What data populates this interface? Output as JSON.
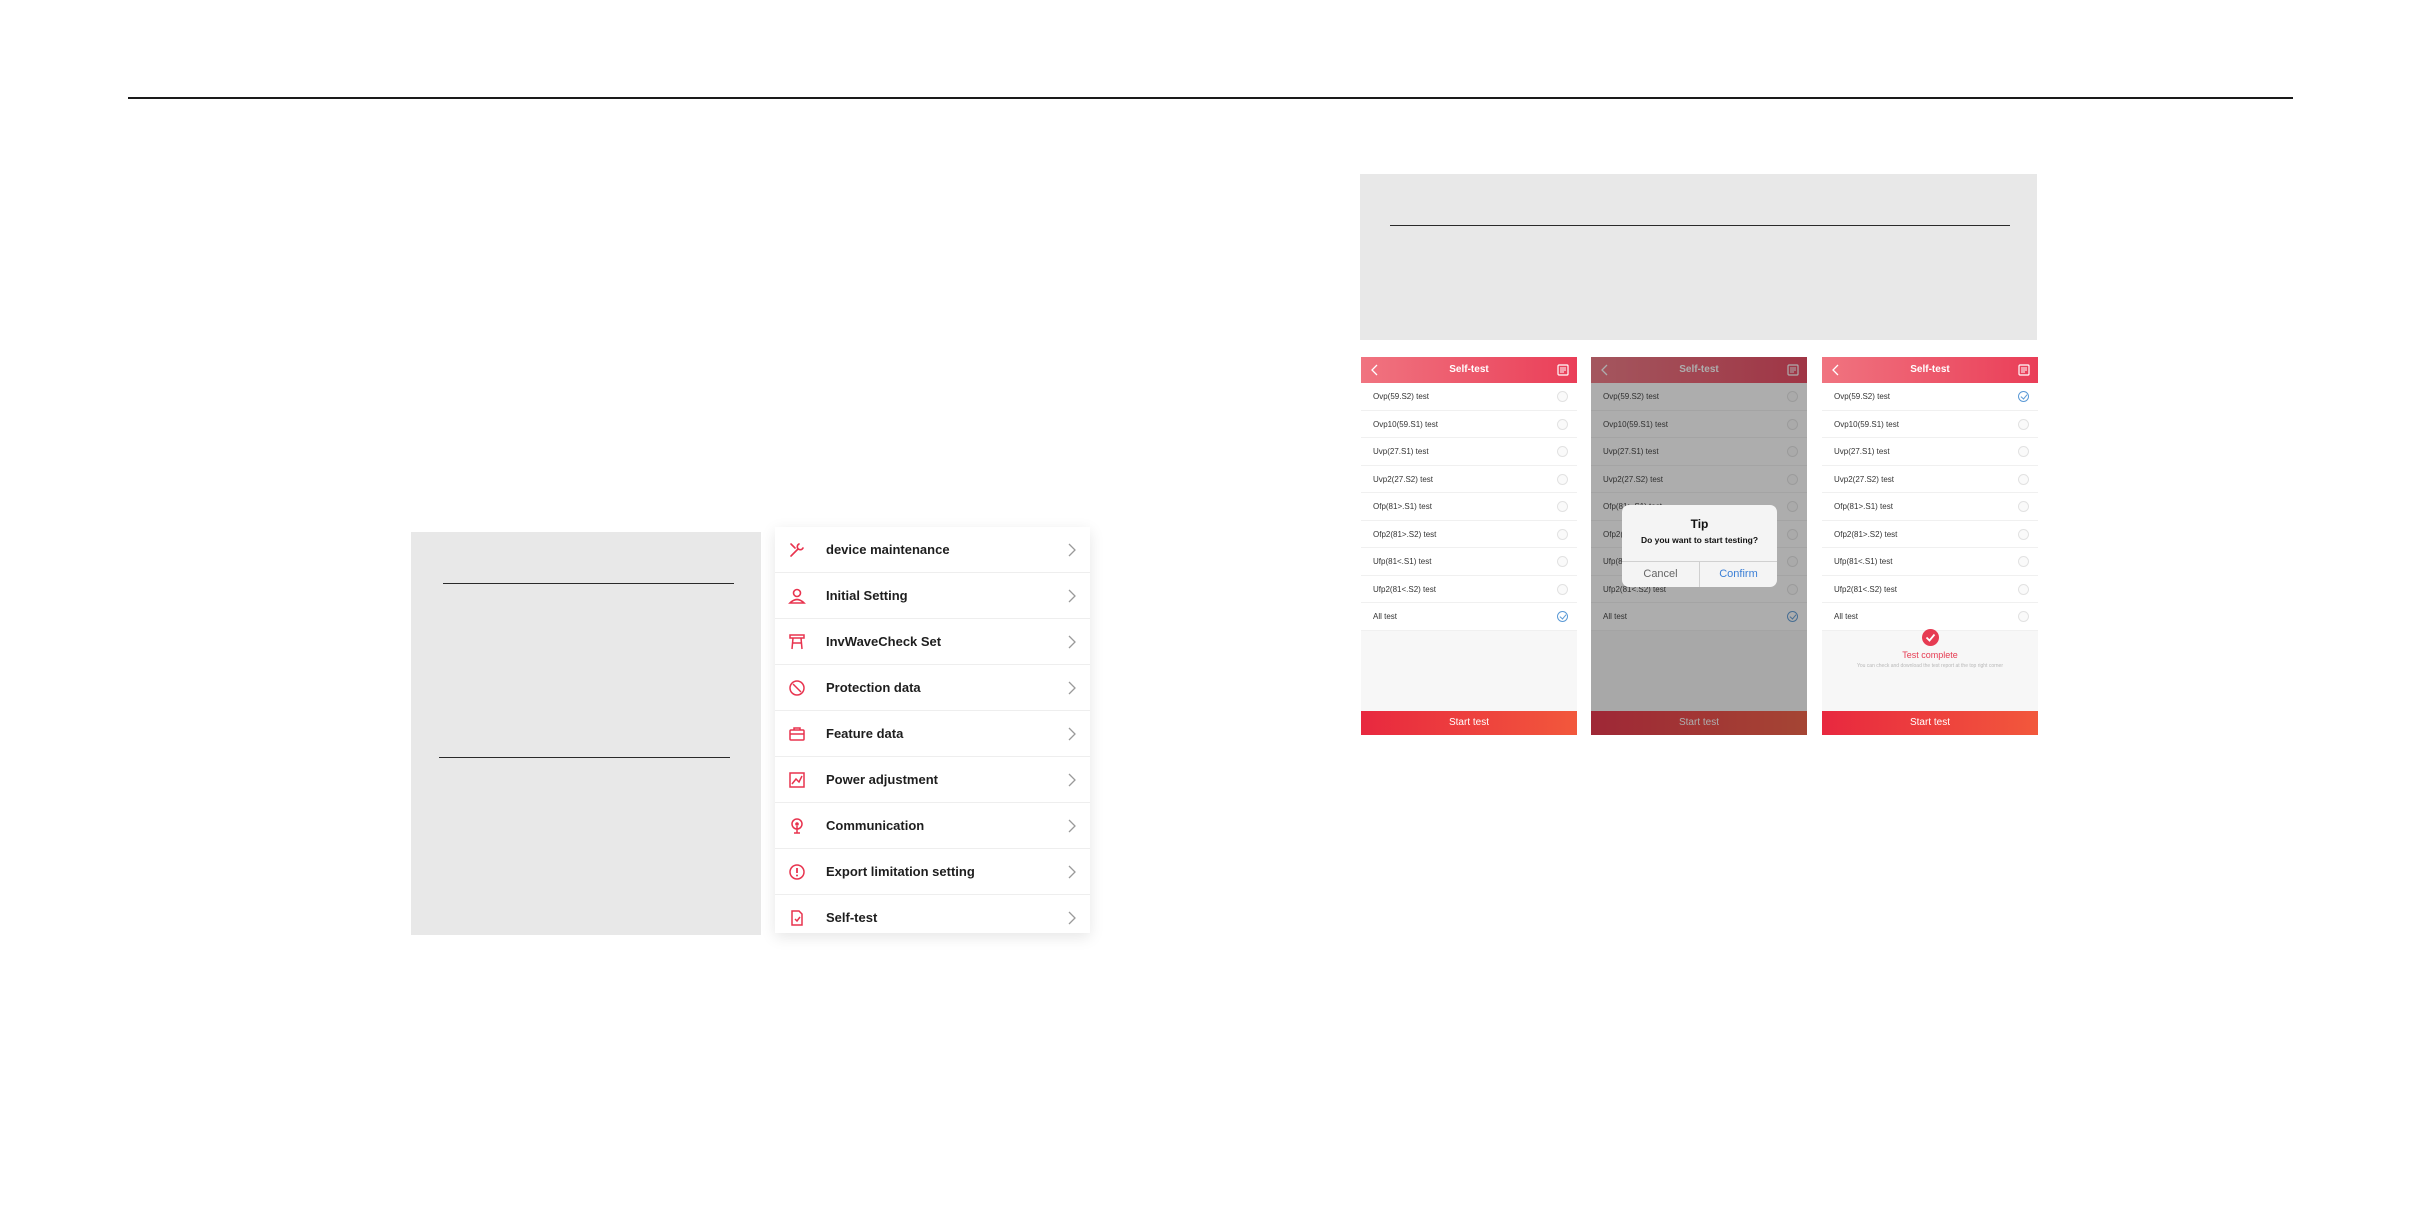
{
  "settings_menu": {
    "items": [
      {
        "label": "device maintenance",
        "icon": "wrench-icon"
      },
      {
        "label": "Initial Setting",
        "icon": "user-setting-icon"
      },
      {
        "label": "InvWaveCheck Set",
        "icon": "tower-icon"
      },
      {
        "label": "Protection data",
        "icon": "shield-icon"
      },
      {
        "label": "Feature data",
        "icon": "briefcase-icon"
      },
      {
        "label": "Power adjustment",
        "icon": "chart-adjust-icon"
      },
      {
        "label": "Communication",
        "icon": "antenna-icon"
      },
      {
        "label": "Export limitation setting",
        "icon": "gauge-icon"
      },
      {
        "label": "Self-test",
        "icon": "document-check-icon"
      }
    ]
  },
  "phones": [
    {
      "title": "Self-test",
      "tests": [
        {
          "label": "Ovp(59.S2)  test",
          "checked": false
        },
        {
          "label": "Ovp10(59.S1)  test",
          "checked": false
        },
        {
          "label": "Uvp(27.S1)  test",
          "checked": false
        },
        {
          "label": "Uvp2(27.S2)  test",
          "checked": false
        },
        {
          "label": "Ofp(81>.S1)  test",
          "checked": false
        },
        {
          "label": "Ofp2(81>.S2)  test",
          "checked": false
        },
        {
          "label": "Ufp(81<.S1)  test",
          "checked": false
        },
        {
          "label": "Ufp2(81<.S2)  test",
          "checked": false
        },
        {
          "label": "All  test",
          "checked": true
        }
      ],
      "start_button": "Start test"
    },
    {
      "title": "Self-test",
      "tests": [
        {
          "label": "Ovp(59.S2)  test",
          "checked": false
        },
        {
          "label": "Ovp10(59.S1)  test",
          "checked": false
        },
        {
          "label": "Uvp(27.S1)  test",
          "checked": false
        },
        {
          "label": "Uvp2(27.S2)  test",
          "checked": false
        },
        {
          "label": "Ofp(81>.S1)  test",
          "checked": false
        },
        {
          "label": "Ofp2(81>.S2)  test",
          "checked": false
        },
        {
          "label": "Ufp(81<.S1)  test",
          "checked": false
        },
        {
          "label": "Ufp2(81<.S2)  test",
          "checked": false
        },
        {
          "label": "All  test",
          "checked": true
        }
      ],
      "start_button": "Start test",
      "dialog": {
        "title": "Tip",
        "message": "Do you want to start testing?",
        "cancel": "Cancel",
        "confirm": "Confirm"
      }
    },
    {
      "title": "Self-test",
      "tests": [
        {
          "label": "Ovp(59.S2)  test",
          "checked": true
        },
        {
          "label": "Ovp10(59.S1)  test",
          "checked": false
        },
        {
          "label": "Uvp(27.S1)  test",
          "checked": false
        },
        {
          "label": "Uvp2(27.S2)  test",
          "checked": false
        },
        {
          "label": "Ofp(81>.S1)  test",
          "checked": false
        },
        {
          "label": "Ofp2(81>.S2)  test",
          "checked": false
        },
        {
          "label": "Ufp(81<.S1)  test",
          "checked": false
        },
        {
          "label": "Ufp2(81<.S2)  test",
          "checked": false
        },
        {
          "label": "All  test",
          "checked": false
        }
      ],
      "start_button": "Start test",
      "complete": {
        "title": "Test complete",
        "subtitle": "You can check and download the test report at the top right corner"
      }
    }
  ],
  "colors": {
    "accent_red": "#ea3e58",
    "header_gradient_start": "#f07480",
    "button_gradient_start": "#e8283f",
    "button_gradient_end": "#f2583c",
    "check_blue": "#5b9ad6",
    "confirm_blue": "#3b7fd6",
    "panel_grey": "#e8e8e8"
  }
}
